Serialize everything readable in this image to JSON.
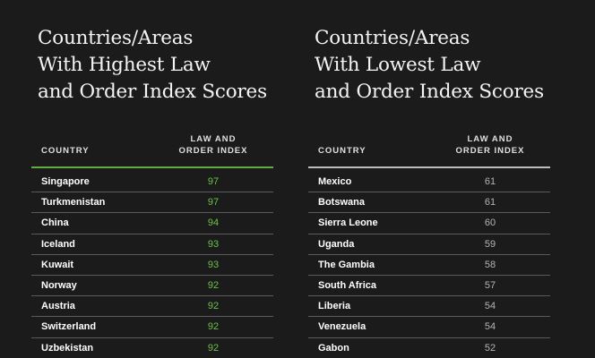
{
  "colors": {
    "background": "#1b1b1b",
    "highest_accent": "#5fae3e",
    "highest_score": "#6cc14a",
    "lowest_accent": "#bdbdbd",
    "lowest_score": "#b5b5b5"
  },
  "chart_data": [
    {
      "type": "table",
      "title_lines": [
        "Countries/Areas",
        "With Highest Law",
        "and Order Index Scores"
      ],
      "columns": {
        "country": "COUNTRY",
        "index_line1": "LAW AND",
        "index_line2": "ORDER INDEX"
      },
      "rows": [
        {
          "country": "Singapore",
          "score": 97
        },
        {
          "country": "Turkmenistan",
          "score": 97
        },
        {
          "country": "China",
          "score": 94
        },
        {
          "country": "Iceland",
          "score": 93
        },
        {
          "country": "Kuwait",
          "score": 93
        },
        {
          "country": "Norway",
          "score": 92
        },
        {
          "country": "Austria",
          "score": 92
        },
        {
          "country": "Switzerland",
          "score": 92
        },
        {
          "country": "Uzbekistan",
          "score": 92
        }
      ]
    },
    {
      "type": "table",
      "title_lines": [
        "Countries/Areas",
        "With Lowest Law",
        "and Order Index Scores"
      ],
      "columns": {
        "country": "COUNTRY",
        "index_line1": "LAW AND",
        "index_line2": "ORDER INDEX"
      },
      "rows": [
        {
          "country": "Mexico",
          "score": 61
        },
        {
          "country": "Botswana",
          "score": 61
        },
        {
          "country": "Sierra Leone",
          "score": 60
        },
        {
          "country": "Uganda",
          "score": 59
        },
        {
          "country": "The Gambia",
          "score": 58
        },
        {
          "country": "South Africa",
          "score": 57
        },
        {
          "country": "Liberia",
          "score": 54
        },
        {
          "country": "Venezuela",
          "score": 54
        },
        {
          "country": "Gabon",
          "score": 52
        }
      ]
    }
  ]
}
